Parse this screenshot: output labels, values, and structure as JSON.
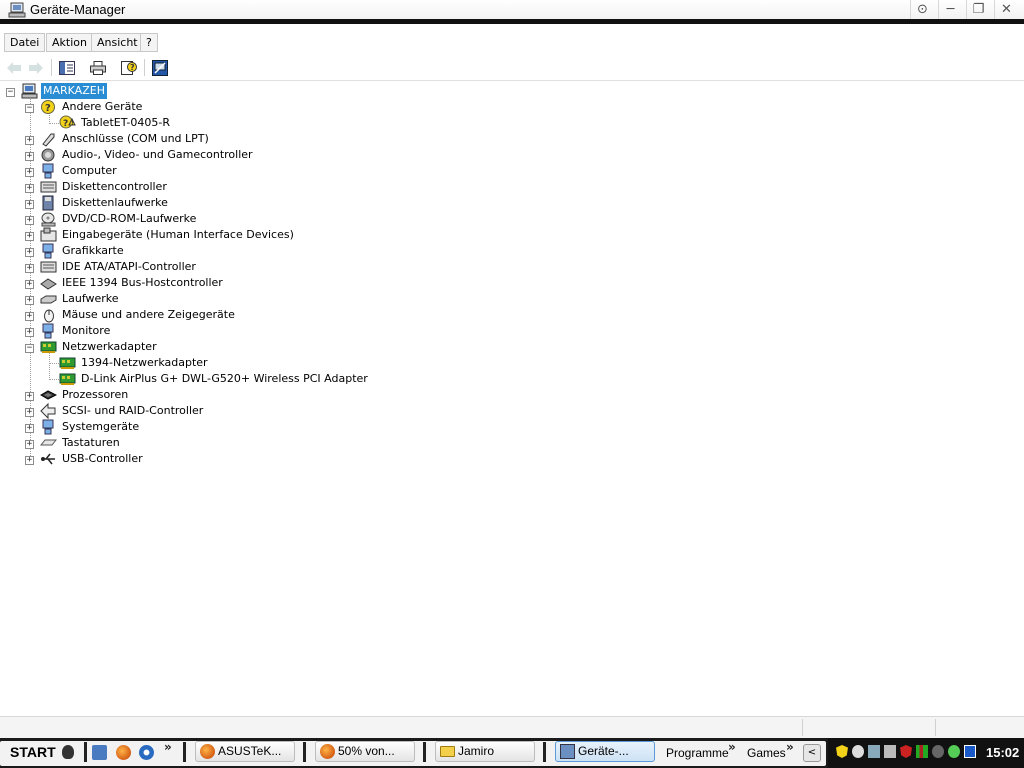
{
  "window": {
    "title": "Geräte-Manager"
  },
  "menu": {
    "file": "Datei",
    "action": "Aktion",
    "view": "Ansicht",
    "help": "?"
  },
  "tree": {
    "root": "MARKAZEH",
    "other_devices": "Andere Geräte",
    "tablet": "TabletET-0405-R",
    "ports": "Anschlüsse (COM und LPT)",
    "audio": "Audio-, Video- und Gamecontroller",
    "computer": "Computer",
    "floppy_controller": "Diskettencontroller",
    "floppy_drives": "Diskettenlaufwerke",
    "dvd": "DVD/CD-ROM-Laufwerke",
    "hid": "Eingabegeräte (Human Interface Devices)",
    "graphics": "Grafikkarte",
    "ide": "IDE ATA/ATAPI-Controller",
    "ieee1394": "IEEE 1394 Bus-Hostcontroller",
    "drives": "Laufwerke",
    "mice": "Mäuse und andere Zeigegeräte",
    "monitors": "Monitore",
    "network": "Netzwerkadapter",
    "net_1394": "1394-Netzwerkadapter",
    "net_dlink": "D-Link AirPlus G+ DWL-G520+ Wireless PCI Adapter",
    "processors": "Prozessoren",
    "scsi": "SCSI- und RAID-Controller",
    "system": "Systemgeräte",
    "keyboards": "Tastaturen",
    "usb": "USB-Controller"
  },
  "taskbar": {
    "start": "START",
    "tasks": [
      "ASUSTeK...",
      "50% von...",
      "Jamiro",
      "Geräte-..."
    ],
    "links": [
      "Programme",
      "Games"
    ],
    "clock": "15:02"
  },
  "colors": {
    "selection": "#2a8dd4",
    "taskbar_bg": "#1a1a1a"
  }
}
